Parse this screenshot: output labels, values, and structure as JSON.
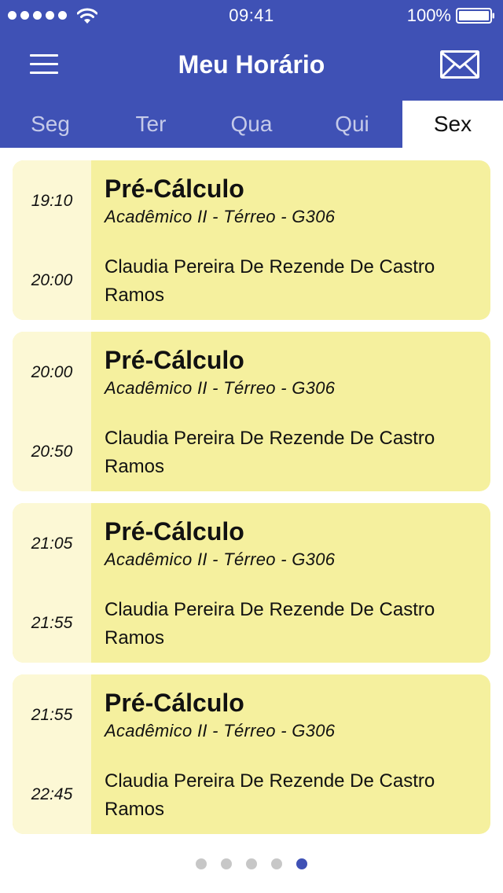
{
  "status": {
    "time": "09:41",
    "battery": "100%"
  },
  "header": {
    "title": "Meu Horário"
  },
  "tabs": [
    {
      "label": "Seg",
      "active": false
    },
    {
      "label": "Ter",
      "active": false
    },
    {
      "label": "Qua",
      "active": false
    },
    {
      "label": "Qui",
      "active": false
    },
    {
      "label": "Sex",
      "active": true
    }
  ],
  "classes": [
    {
      "start": "19:10",
      "end": "20:00",
      "name": "Pré-Cálculo",
      "location": "Acadêmico II - Térreo - G306",
      "professor": "Claudia Pereira De Rezende De Castro Ramos"
    },
    {
      "start": "20:00",
      "end": "20:50",
      "name": "Pré-Cálculo",
      "location": "Acadêmico II - Térreo - G306",
      "professor": "Claudia Pereira De Rezende De Castro Ramos"
    },
    {
      "start": "21:05",
      "end": "21:55",
      "name": "Pré-Cálculo",
      "location": "Acadêmico II - Térreo - G306",
      "professor": "Claudia Pereira De Rezende De Castro Ramos"
    },
    {
      "start": "21:55",
      "end": "22:45",
      "name": "Pré-Cálculo",
      "location": "Acadêmico II - Térreo - G306",
      "professor": "Claudia Pereira De Rezende De Castro Ramos"
    }
  ],
  "pager": {
    "count": 5,
    "active_index": 4
  },
  "colors": {
    "primary": "#3f51b5",
    "card": "#f5f09e",
    "card_time": "#fcf8d5"
  },
  "icons": {
    "menu": "hamburger-menu-icon",
    "mail": "envelope-icon",
    "wifi": "wifi-icon",
    "battery": "battery-icon"
  }
}
